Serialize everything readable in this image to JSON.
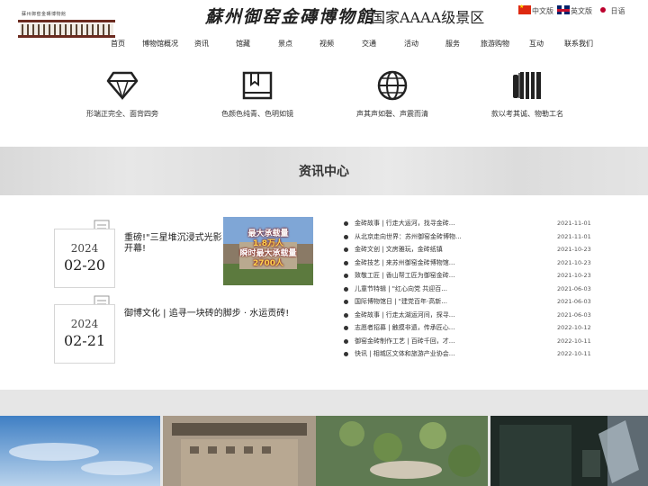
{
  "header": {
    "logo_text": "蘇州御窑金磚博物館",
    "brand_title": "蘇州御窑金磚博物館",
    "brand_rating": "国家AAAA级景区",
    "languages": [
      {
        "label": "中文版",
        "icon": "cn-flag-icon"
      },
      {
        "label": "英文版",
        "icon": "uk-flag-icon"
      },
      {
        "label": "日语",
        "icon": "jp-flag-icon"
      }
    ]
  },
  "nav": [
    "首页",
    "博物馆概况",
    "资讯",
    "馆藏",
    "景点",
    "视频",
    "交通",
    "活动",
    "服务",
    "旅游购物",
    "互动",
    "联系我们"
  ],
  "features": [
    {
      "icon": "diamond-icon",
      "label": "形端正完全、面背四旁"
    },
    {
      "icon": "book-icon",
      "label": "色颜色纯青、色明如镜"
    },
    {
      "icon": "globe-icon",
      "label": "声其声如磬、声震而清"
    },
    {
      "icon": "scroll-icon",
      "label": "款以考其诚、物勒工名"
    }
  ],
  "news_section": {
    "title": "资讯中心",
    "featured": [
      {
        "year": "2024",
        "date": "02-20",
        "title": "重磅!\"三星堆沉浸式光影开幕!"
      },
      {
        "year": "2024",
        "date": "02-21",
        "title": "御博文化 | 追寻一块砖的脚步 · 水运贡砖!"
      }
    ],
    "featured_image": {
      "line1": "最大承载量",
      "line2": "1.8万人",
      "line3": "瞬时最大承载量",
      "line4": "2700人"
    },
    "list": [
      {
        "title": "金砖故事 | 行走大运河，找寻金砖...",
        "date": "2021-11-01"
      },
      {
        "title": "从北京走向世界：苏州御窑金砖博物...",
        "date": "2021-11-01"
      },
      {
        "title": "金砖文创 | 文房雅玩，金砖纸镇",
        "date": "2021-10-23"
      },
      {
        "title": "金砖技艺 | 来苏州御窑金砖博物馆...",
        "date": "2021-10-23"
      },
      {
        "title": "致敬工匠 | 香山帮工匠为御窑金砖...",
        "date": "2021-10-23"
      },
      {
        "title": "儿童节特辑 | \"红心向党 共迎百...",
        "date": "2021-06-03"
      },
      {
        "title": "国际博物馆日 | \"建党百年·高新...",
        "date": "2021-06-03"
      },
      {
        "title": "金砖故事 | 行走太湖运河间，探寻...",
        "date": "2021-06-03"
      },
      {
        "title": "志愿者招募 | 触摸非遗，传承匠心...",
        "date": "2022-10-12"
      },
      {
        "title": "御窑金砖制作工艺 | 百砖千回，才...",
        "date": "2022-10-11"
      },
      {
        "title": "快讯 | 相城区文体和旅游产业协会...",
        "date": "2022-10-11"
      }
    ]
  },
  "photo_gallery": [
    {
      "icon": "sky-photo"
    },
    {
      "icon": "museum-aerial-photo"
    },
    {
      "icon": "exhibit-photo"
    }
  ]
}
